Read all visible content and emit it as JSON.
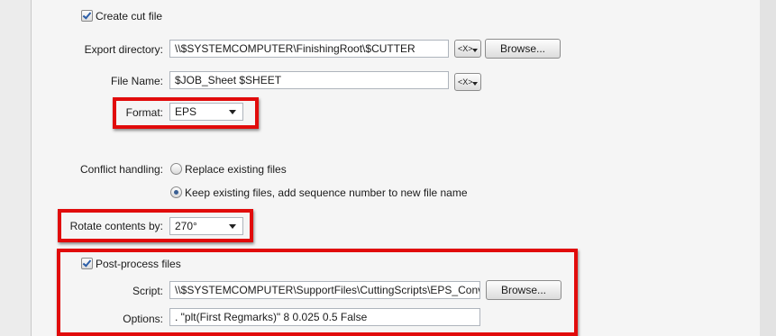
{
  "create_cut_file": {
    "label": "Create cut file",
    "checked": true
  },
  "export_directory": {
    "label": "Export directory:",
    "value": "\\\\$SYSTEMCOMPUTER\\FinishingRoot\\$CUTTER",
    "browse_label": "Browse..."
  },
  "file_name": {
    "label": "File Name:",
    "value": "$JOB_Sheet $SHEET"
  },
  "variable_button_label": "<X>",
  "format": {
    "label": "Format:",
    "value": "EPS"
  },
  "conflict_handling": {
    "label": "Conflict handling:",
    "options": [
      {
        "label": "Replace existing files",
        "selected": false
      },
      {
        "label": "Keep existing files, add sequence number to new file name",
        "selected": true
      }
    ]
  },
  "rotate": {
    "label": "Rotate contents by:",
    "value": "270°"
  },
  "post_process": {
    "label": "Post-process files",
    "checked": true,
    "script_label": "Script:",
    "script_value": "\\\\$SYSTEMCOMPUTER\\SupportFiles\\CuttingScripts\\EPS_Conv",
    "browse_label": "Browse...",
    "options_label": "Options:",
    "options_value": ". \"plt(First Regmarks)\" 8 0.025 0.5 False"
  },
  "highlight_color": "#e10b0b"
}
